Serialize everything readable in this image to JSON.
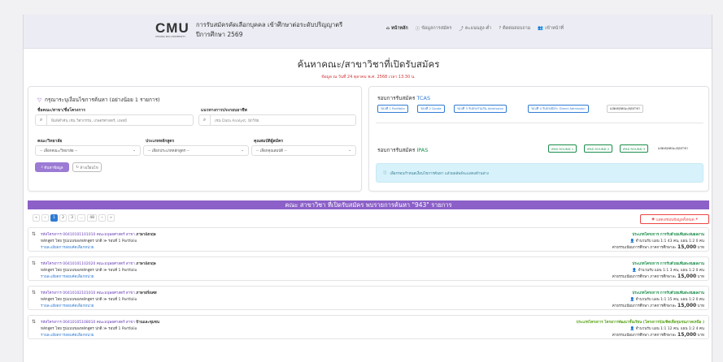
{
  "header": {
    "logo_text": "CMU",
    "logo_sub": "CHIANG MAI UNIVERSITY",
    "title": "การรับสมัครคัดเลือกบุคคล เข้าศึกษาต่อระดับปริญญาตรี",
    "year": "ปีการศึกษา 2569",
    "menu": [
      {
        "label": "หน้าหลัก",
        "icon": "home-icon"
      },
      {
        "label": "ข้อมูลการสมัคร",
        "icon": "info-icon"
      },
      {
        "label": "คะแนนสูง-ต่ำ",
        "icon": "chart-icon"
      },
      {
        "label": "ติดต่อสอบถาม",
        "icon": "question-icon"
      },
      {
        "label": "เข้าหน้าที่",
        "icon": "staff-icon"
      }
    ]
  },
  "page": {
    "heading": "ค้นหาคณะ/สาขาวิชาที่เปิดรับสมัคร",
    "updated": "ข้อมูล ณ วันที่ 24 ตุลาคม พ.ศ. 2568 เวลา 13:30 น."
  },
  "filter": {
    "title": "กรุณาระบุเงื่อนไขการค้นหา (อย่างน้อย 1 รายการ)",
    "faculty_label": "ชื่อคณะ/สาขา/ชื่อโครงการ",
    "faculty_placeholder": "พิมพ์คำค้น เช่น วิศวกรรม, เกษตรศาสตร์, แพทย์",
    "career_label": "แนวทางการประกอบอาชีพ",
    "career_placeholder": "เช่น Data Analyst, นักวิจัย",
    "faculty_select_label": "คณะ/วิทยาลัย",
    "faculty_select_value": "-- เลือกคณะ/วิทยาลัย --",
    "curriculum_label": "ประเภทหลักสูตร",
    "curriculum_value": "-- เลือกประเภทหลักสูตร --",
    "qualification_label": "คุณสมบัติผู้สมัคร",
    "qualification_value": "-- เลือกคุณสมบัติ --",
    "search_button": "ค้นหาข้อมูล",
    "clear_button": "ล้างเงื่อนไข"
  },
  "rounds": {
    "tcas_title_prefix": "รอบการรับสมัคร",
    "tcas_name": "TCAS",
    "tcas_pills": [
      "รอบที่ 1 Portfolio",
      "รอบที่ 2 Quota",
      "รอบที่ 3 รับตรงร่วมกัน Admission",
      "รอบที่ 4 รับตรงอิสระ Direct Admission",
      "แสดงทุกคณะ/ทุกสาขา"
    ],
    "ipas_title_prefix": "รอบการรับสมัคร",
    "ipas_name": "IPAS",
    "ipas_pills": [
      "IPAS ROUND 1",
      "IPAS ROUND 2",
      "IPAS ROUND 3",
      "แสดงทุกคณะ/ทุกสาขา"
    ],
    "alert": "เลือกรอบกำหนดเงื่อนไขการค้นหา แล้วผลลัพธ์จะแสดงด้านล่าง"
  },
  "results": {
    "banner": "คณะ สาขาวิชา ที่เปิดรับสมัคร พบรายการค้นหา \"943\" รายการ",
    "pages": [
      "«",
      "‹",
      "1",
      "2",
      "3",
      "...",
      "48",
      "›",
      "»"
    ],
    "toggle_all": "แสดง/ซ่อนข้อมูลทั้งหมด",
    "rows": [
      {
        "code": "รหัสโครงการ 00410101101010 คณะมนุษยศาสตร์ สาขา",
        "major": "ภาษาอังกฤษ",
        "curriculum": "หลักสูตร ไทย รูปแบบของหลักสูตร ปกติ  ≫ รอบที่ 1 Portfolio",
        "link": "รายละเอียดการสอบคัดเลือกหน่วย",
        "project": "ประเภทโครงการ การรับด้วยแฟ้มสะสมผลงาน",
        "seats": "จำนวนรับ แผน 1:1 43 คน, แผน 1:2 0 คน",
        "fee_label": "ค่าธรรมเนียมการศึกษา ภาคการศึกษาละ",
        "fee": "15,000",
        "fee_unit": "บาท",
        "lime": false
      },
      {
        "code": "รหัสโครงการ 00410101102020 คณะมนุษยศาสตร์ สาขา",
        "major": "ภาษาอังกฤษ",
        "curriculum": "หลักสูตร ไทย รูปแบบของหลักสูตร ปกติ  ≫ รอบที่ 1 Portfolio",
        "link": "รายละเอียดการสอบคัดเลือกหน่วย",
        "project": "ประเภทโครงการ การรับด้วยแฟ้มสะสมผลงาน",
        "seats": "จำนวนรับ แผน 1:1 3 คน, แผน 1:2 0 คน",
        "fee_label": "ค่าธรรมเนียมการศึกษา ภาคการศึกษาละ",
        "fee": "15,000",
        "fee_unit": "บาท",
        "lime": false
      },
      {
        "code": "รหัสโครงการ 00410102101010 คณะมนุษยศาสตร์ สาขา",
        "major": "ภาษาฝรั่งเศส",
        "curriculum": "หลักสูตร ไทย รูปแบบของหลักสูตร ปกติ  ≫ รอบที่ 1 Portfolio",
        "link": "รายละเอียดการสอบคัดเลือกหน่วย",
        "project": "ประเภทโครงการ การรับด้วยแฟ้มสะสมผลงาน",
        "seats": "จำนวนรับ แผน 1:1 15 คน, แผน 1:2 0 คน",
        "fee_label": "ค่าธรรมเนียมการศึกษา ภาคการศึกษาละ",
        "fee": "15,000",
        "fee_unit": "บาท",
        "lime": false
      },
      {
        "code": "รหัสโครงการ 00410105108010 คณะมนุษยศาสตร์ สาขา",
        "major": "บ้านและชุมชน",
        "curriculum": "หลักสูตร ไทย รูปแบบของหลักสูตร ปกติ  ≫ รอบที่ 1 Portfolio",
        "link": "รายละเอียดการสอบคัดเลือกหน่วย",
        "project": "ประเภทโครงการ โครงการพัฒนาชั้นเรียน (โครงการบัณฑิตเพื่อชุมชนภาคเหนือ )",
        "seats": "จำนวนรับ แผน 1:1 12 คน, แผน 1:2 4 คน",
        "fee_label": "ค่าธรรมเนียมการศึกษา ภาคการศึกษาละ",
        "fee": "15,000",
        "fee_unit": "บาท",
        "lime": true
      }
    ]
  },
  "colors": {
    "brand": "#6a40b8",
    "banner": "#8c60c8",
    "link": "#2f7bd3",
    "green": "#1a8e4a"
  }
}
